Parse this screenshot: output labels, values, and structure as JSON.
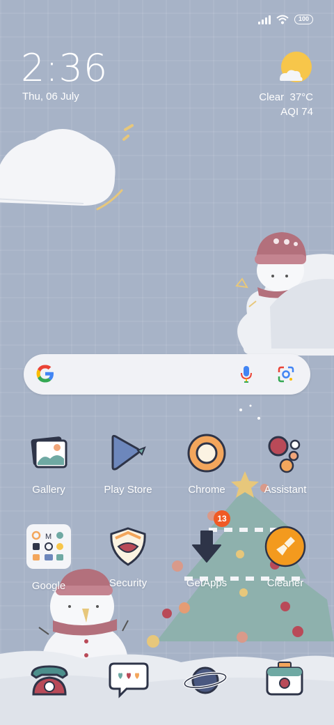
{
  "status_bar": {
    "battery_level": "100",
    "icons": [
      "signal-icon",
      "wifi-icon",
      "battery-icon"
    ]
  },
  "clock": {
    "time": "2:36",
    "date": "Thu, 06 July"
  },
  "weather": {
    "condition": "Clear",
    "temperature": "37°C",
    "aqi": "AQI 74",
    "icon": "sun-cloud-icon"
  },
  "search_widget": {
    "icons": [
      "google-g-icon",
      "microphone-icon",
      "google-lens-icon"
    ]
  },
  "apps": {
    "gallery": "Gallery",
    "play_store": "Play Store",
    "chrome": "Chrome",
    "assistant": "Assistant",
    "google": "Google",
    "security": "Security",
    "getapps": "GetApps",
    "getapps_badge": "13",
    "cleaner": "Cleaner"
  },
  "dock": [
    "phone-icon",
    "messages-icon",
    "browser-icon",
    "camera-icon"
  ],
  "colors": {
    "wallpaper": "#a7b3c7",
    "badge": "#f05a24",
    "cleaner_orange": "#f39a1e"
  }
}
